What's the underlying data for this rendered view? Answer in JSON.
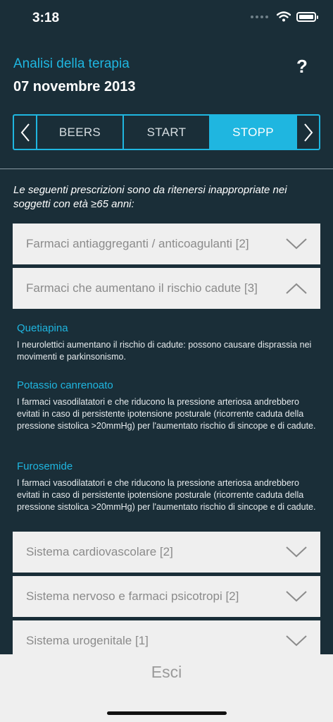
{
  "status": {
    "time": "3:18"
  },
  "header": {
    "title": "Analisi della terapia",
    "date": "07 novembre 2013",
    "help": "?"
  },
  "tabs": [
    {
      "label": "BEERS",
      "active": false
    },
    {
      "label": "START",
      "active": false
    },
    {
      "label": "STOPP",
      "active": true
    }
  ],
  "intro": "Le seguenti prescrizioni sono da ritenersi inappropriate nei soggetti con età ≥65 anni:",
  "sections": [
    {
      "label": "Farmaci antiaggreganti / anticoagulanti [2]",
      "expanded": false
    },
    {
      "label": "Farmaci che aumentano il rischio cadute [3]",
      "expanded": true
    },
    {
      "label": "Sistema cardiovascolare [2]",
      "expanded": false
    },
    {
      "label": "Sistema nervoso e farmaci psicotropi [2]",
      "expanded": false
    },
    {
      "label": "Sistema urogenitale [1]",
      "expanded": false
    }
  ],
  "items": [
    {
      "title": "Quetiapina",
      "text": "I neurolettici aumentano il rischio di cadute: possono causare disprassia nei movimenti e parkinsonismo."
    },
    {
      "title": "Potassio canrenoato",
      "text": "I farmaci vasodilatatori e che riducono la pressione arteriosa andrebbero evitati in caso di persistente ipotensione posturale (ricorrente caduta della pressione sistolica >20mmHg) per l'aumentato rischio di sincope e di cadute."
    },
    {
      "title": "Furosemide",
      "text": "I farmaci vasodilatatori e che riducono la pressione arteriosa andrebbero evitati in caso di persistente ipotensione posturale (ricorrente caduta della pressione sistolica >20mmHg) per l'aumentato rischio di sincope e di cadute."
    }
  ],
  "footer": {
    "exit_label": "Esci"
  },
  "colors": {
    "background": "#1a2e38",
    "accent": "#1fb6e0",
    "panel": "#efefef"
  }
}
